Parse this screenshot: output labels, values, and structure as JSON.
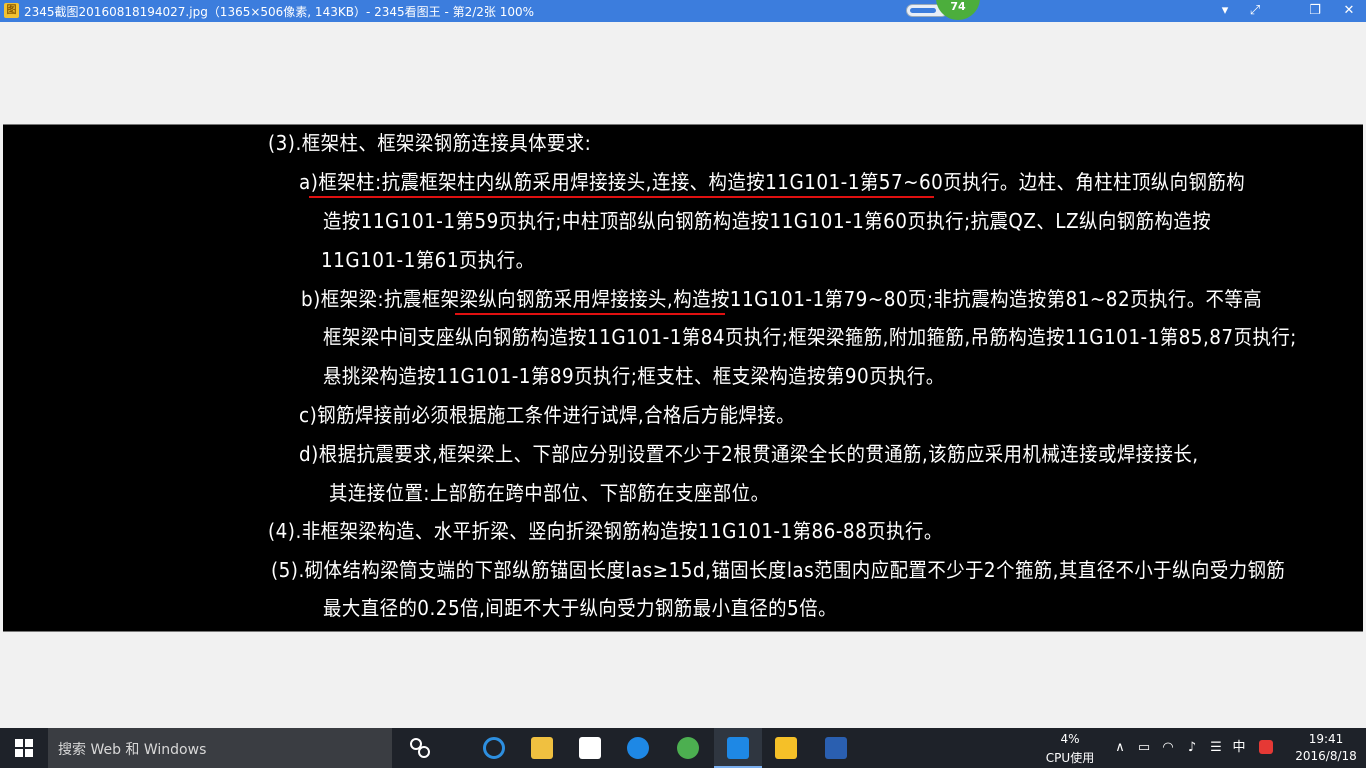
{
  "window": {
    "title": "2345截图20160818194027.jpg（1365×506像素, 143KB）- 2345看图王 - 第2/2张 100%",
    "meter_value": "74",
    "controls": [
      "▾",
      "⤢",
      "❐",
      "✕"
    ]
  },
  "document": {
    "lines": [
      "(3).框架柱、框架梁钢筋连接具体要求:",
      "a)框架柱:抗震框架柱内纵筋采用焊接接头,连接、构造按11G101-1第57~60页执行。边柱、角柱柱顶纵向钢筋构",
      "造按11G101-1第59页执行;中柱顶部纵向钢筋构造按11G101-1第60页执行;抗震QZ、LZ纵向钢筋构造按",
      "11G101-1第61页执行。",
      "b)框架梁:抗震框架梁纵向钢筋采用焊接接头,构造按11G101-1第79~80页;非抗震构造按第81~82页执行。不等高",
      "框架梁中间支座纵向钢筋构造按11G101-1第84页执行;框架梁箍筋,附加箍筋,吊筋构造按11G101-1第85,87页执行;",
      "悬挑梁构造按11G101-1第89页执行;框支柱、框支梁构造按第90页执行。",
      "c)钢筋焊接前必须根据施工条件进行试焊,合格后方能焊接。",
      "d)根据抗震要求,框架梁上、下部应分别设置不少于2根贯通梁全长的贯通筋,该筋应采用机械连接或焊接接长,",
      "其连接位置:上部筋在跨中部位、下部筋在支座部位。",
      "(4).非框架梁构造、水平折梁、竖向折梁钢筋构造按11G101-1第86-88页执行。",
      "(5).砌体结构梁筒支端的下部纵筋锚固长度las≥15d,锚固长度las范围内应配置不少于2个箍筋,其直径不小于纵向受力钢筋",
      "最大直径的0.25倍,间距不大于纵向受力钢筋最小直径的5倍。"
    ],
    "underline_color": "#e01010"
  },
  "taskbar": {
    "search_placeholder": "搜索 Web 和 Windows",
    "cpu_percent": "4%",
    "cpu_label": "CPU使用",
    "ime": "中",
    "time": "19:41",
    "date": "2016/8/18"
  }
}
